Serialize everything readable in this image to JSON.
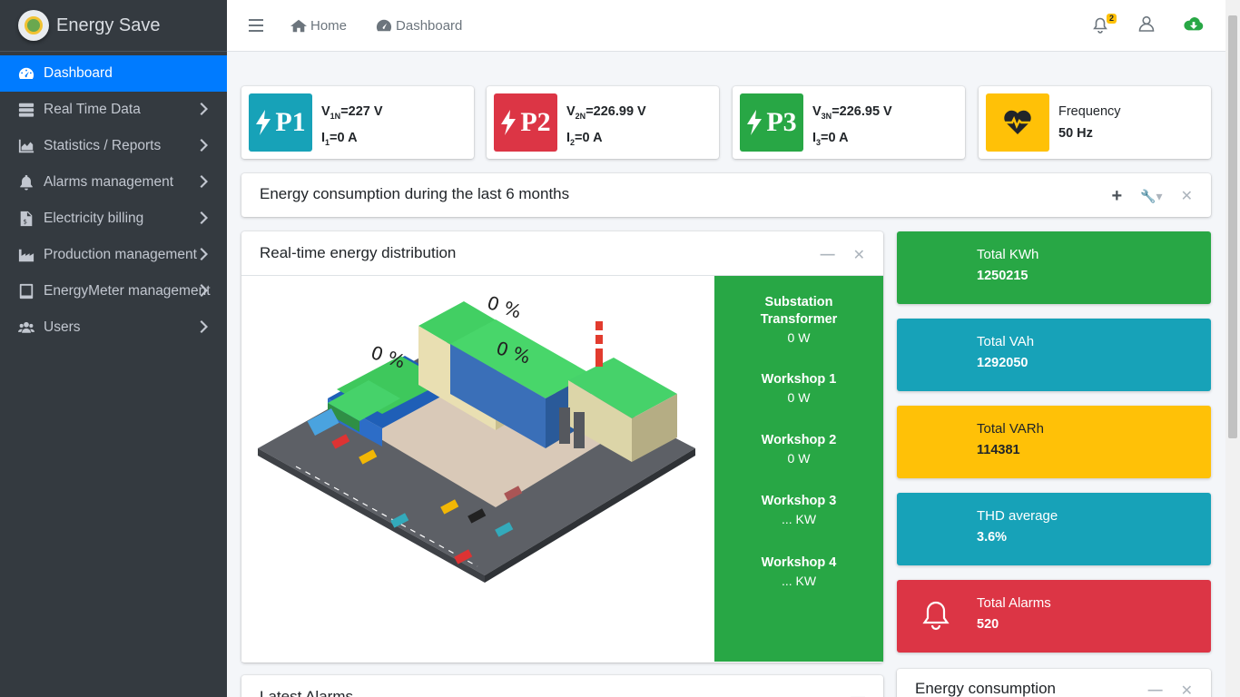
{
  "brand": {
    "name": "Energy Save"
  },
  "sidebar": {
    "items": [
      {
        "label": "Dashboard",
        "icon": "tachometer-icon",
        "active": true
      },
      {
        "label": "Real Time Data",
        "icon": "server-icon"
      },
      {
        "label": "Statistics / Reports",
        "icon": "area-chart-icon"
      },
      {
        "label": "Alarms management",
        "icon": "bell-icon"
      },
      {
        "label": "Electricity billing",
        "icon": "invoice-icon"
      },
      {
        "label": "Production management",
        "icon": "industry-icon"
      },
      {
        "label": "EnergyMeter management",
        "icon": "tablet-icon"
      },
      {
        "label": "Users",
        "icon": "users-icon"
      }
    ]
  },
  "header": {
    "home": "Home",
    "dashboard": "Dashboard",
    "notifications_count": "2"
  },
  "phases": [
    {
      "label": "P1",
      "color": "#17a2b8",
      "voltage_label": "V",
      "voltage_sub": "1N",
      "voltage_value": "=227 V",
      "current_label": "I",
      "current_sub": "1",
      "current_value": "=0 A"
    },
    {
      "label": "P2",
      "color": "#dc3545",
      "voltage_label": "V",
      "voltage_sub": "2N",
      "voltage_value": "=226.99 V",
      "current_label": "I",
      "current_sub": "2",
      "current_value": "=0 A"
    },
    {
      "label": "P3",
      "color": "#28a745",
      "voltage_label": "V",
      "voltage_sub": "3N",
      "voltage_value": "=226.95 V",
      "current_label": "I",
      "current_sub": "3",
      "current_value": "=0 A"
    }
  ],
  "frequency": {
    "label": "Frequency",
    "value": "50 Hz",
    "color": "#ffc107"
  },
  "consumption_card": {
    "title": "Energy consumption during the last 6 months"
  },
  "distribution": {
    "title": "Real-time energy distribution",
    "building_percents": [
      "0 %",
      "0 %",
      "0 %"
    ],
    "items": [
      {
        "name": "Substation Transformer",
        "value": "0 W"
      },
      {
        "name": "Workshop 1",
        "value": "0 W"
      },
      {
        "name": "Workshop 2",
        "value": "0 W"
      },
      {
        "name": "Workshop 3",
        "value": "... KW"
      },
      {
        "name": "Workshop 4",
        "value": "... KW"
      }
    ]
  },
  "stats": [
    {
      "label": "Total KWh",
      "value": "1250215",
      "color": "#28a745"
    },
    {
      "label": "Total VAh",
      "value": "1292050",
      "color": "#17a2b8"
    },
    {
      "label": "Total VARh",
      "value": "114381",
      "color": "#ffc107"
    },
    {
      "label": "THD average",
      "value": "3.6%",
      "color": "#17a2b8"
    },
    {
      "label": "Total Alarms",
      "value": "520",
      "color": "#dc3545"
    }
  ],
  "bottom": {
    "alarms_title": "Latest Alarms",
    "energy_title": "Energy consumption"
  }
}
